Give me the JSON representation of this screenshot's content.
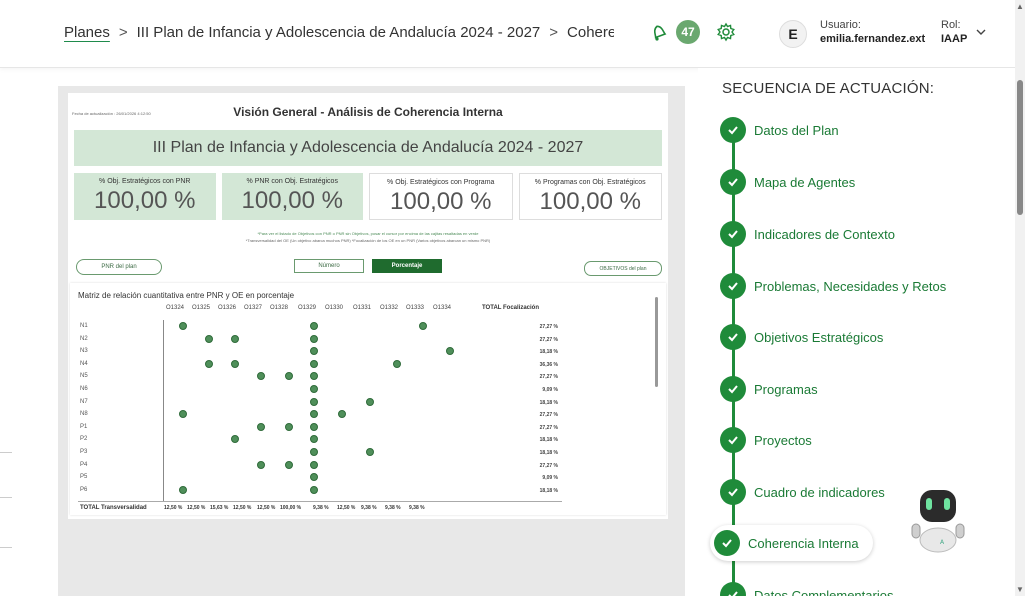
{
  "header": {
    "breadcrumb_root": "Planes",
    "breadcrumb_plan": "III Plan de Infancia y Adolescencia de Andalucía 2024 - 2027",
    "breadcrumb_current": "Coherencia Interna",
    "notifications_count": "47",
    "avatar_initial": "E",
    "user_label": "Usuario:",
    "user_value": "emilia.fernandez.ext",
    "rol_label": "Rol:",
    "rol_value": "IAAP"
  },
  "report": {
    "update_date": "Fecha de actualización : 26/01/2026 4:12:50",
    "title": "Visión General - Análisis de Coherencia Interna",
    "plan_name": "III Plan de Infancia y Adolescencia de Andalucía 2024 - 2027",
    "kpis": [
      {
        "label": "% Obj. Estratégicos con PNR",
        "value": "100,00 %"
      },
      {
        "label": "% PNR con Obj. Estratégicos",
        "value": "100,00 %"
      },
      {
        "label": "% Obj. Estratégicos con Programa",
        "value": "100,00 %"
      },
      {
        "label": "% Programas con Obj. Estratégicos",
        "value": "100,00 %"
      }
    ],
    "note_1": "*Para ver el listado de Objetivos con PNR o PNR sin Objetivos, posar el cursor por encima de las cajitas resaltadas en verde",
    "note_2": "*Transversalidad del OE (Un objetivo abarca muchos PNR)      *Focalización de los OE en un  PNR (Varios objetivos abarcan un mismo PNR)",
    "btn_pnr": "PNR del plan",
    "btn_numero": "Número",
    "btn_porcentaje": "Porcentaje",
    "btn_objetivos": "OBJETIVOS del plan",
    "matrix_title": "Matriz de relación cuantitativa entre PNR y OE en porcentaje",
    "columns": [
      "O1324",
      "O1325",
      "O1326",
      "O1327",
      "O1328",
      "O1329",
      "O1330",
      "O1331",
      "O1332",
      "O1333",
      "O1334"
    ],
    "total_col_label": "TOTAL Focalización",
    "rows": [
      {
        "label": "N1",
        "total": "27,27 %"
      },
      {
        "label": "N2",
        "total": "27,27 %"
      },
      {
        "label": "N3",
        "total": "18,18 %"
      },
      {
        "label": "N4",
        "total": "36,36 %"
      },
      {
        "label": "N5",
        "total": "27,27 %"
      },
      {
        "label": "N6",
        "total": "9,09 %"
      },
      {
        "label": "N7",
        "total": "18,18 %"
      },
      {
        "label": "N8",
        "total": "27,27 %"
      },
      {
        "label": "P1",
        "total": "27,27 %"
      },
      {
        "label": "P2",
        "total": "18,18 %"
      },
      {
        "label": "P3",
        "total": "18,18 %"
      },
      {
        "label": "P4",
        "total": "27,27 %"
      },
      {
        "label": "P5",
        "total": "9,09 %"
      },
      {
        "label": "P6",
        "total": "18,18 %"
      }
    ],
    "total_row_label": "TOTAL Transversalidad",
    "total_row_values": [
      "12,50 %",
      "12,50 %",
      "15,63 %",
      "12,50 %",
      "12,50 %",
      "100,00 %",
      "9,38 %",
      "12,50 %",
      "9,38 %",
      "9,38 %",
      "9,38 %"
    ]
  },
  "sequence": {
    "title": "SECUENCIA DE ACTUACIÓN:",
    "steps": [
      "Datos del Plan",
      "Mapa de Agentes",
      "Indicadores de Contexto",
      "Problemas, Necesidades y Retos",
      "Objetivos Estratégicos",
      "Programas",
      "Proyectos",
      "Cuadro de indicadores",
      "Coherencia Interna",
      "Datos Complementarios"
    ],
    "active_step": "Coherencia Interna"
  },
  "colors": {
    "accent_green": "#1f8b3a",
    "kpi_bg": "#d3e7d6",
    "dark_green_button": "#1f6b2e",
    "badge": "#6aa86f"
  }
}
